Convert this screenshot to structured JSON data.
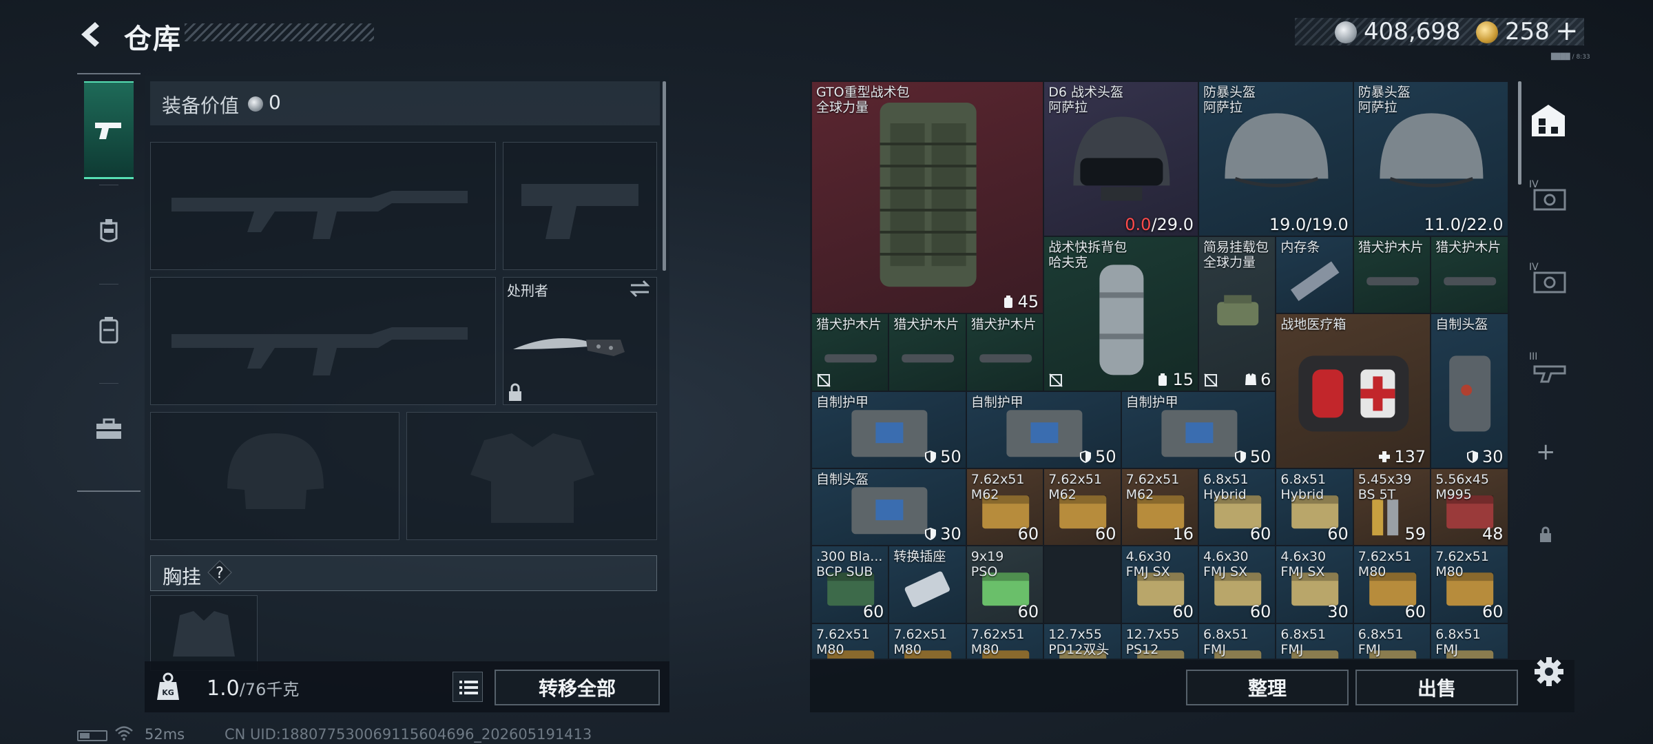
{
  "header": {
    "title": "仓库",
    "silver": "408,698",
    "gold": "258",
    "tiny_text": "████ / 8:33"
  },
  "left": {
    "value_label": "装备价值",
    "value_amount": "0",
    "knife_name": "处刑者",
    "chest_label": "胸挂",
    "chest_help": "?",
    "weight_value": "1.0",
    "weight_max": "/76千克",
    "transfer_all": "转移全部"
  },
  "storage_items": [
    {
      "name": "GTO重型战术包\n全球力量",
      "qty": "45",
      "qty_icon": "backpack-icon",
      "rarity": "red"
    },
    {
      "name": "D6 战术头盔\n阿萨拉",
      "qty_red": "0.0",
      "qty": "/29.0",
      "rarity": "purple"
    },
    {
      "name": "防暴头盔\n阿萨拉",
      "qty": "19.0/19.0",
      "rarity": "blue"
    },
    {
      "name": "防暴头盔\n阿萨拉",
      "qty": "11.0/22.0",
      "rarity": "blue"
    },
    {
      "name": "战术快拆背包\n哈夫克",
      "qty": "15",
      "qty_icon": "backpack-icon",
      "rarity": "green"
    },
    {
      "name": "简易挂载包\n全球力量",
      "qty": "6",
      "qty_icon": "vest-icon",
      "rarity": "gray"
    },
    {
      "name": "内存条",
      "qty": "",
      "rarity": "blue"
    },
    {
      "name": "猎犬护木片",
      "qty": "",
      "rarity": "green"
    },
    {
      "name": "猎犬护木片",
      "qty": "",
      "rarity": "green"
    },
    {
      "name": "猎犬护木片",
      "qty": "",
      "rarity": "green"
    },
    {
      "name": "猎犬护木片",
      "qty": "",
      "rarity": "green"
    },
    {
      "name": "猎犬护木片",
      "qty": "",
      "rarity": "green"
    },
    {
      "name": "战地医疗箱",
      "qty": "137",
      "qty_icon": "plus-icon",
      "rarity": "orange"
    },
    {
      "name": "自制头盔",
      "qty": "30",
      "qty_icon": "shield-icon",
      "rarity": "blue"
    },
    {
      "name": "自制护甲",
      "qty": "50",
      "qty_icon": "shield-icon",
      "rarity": "blue"
    },
    {
      "name": "自制护甲",
      "qty": "50",
      "qty_icon": "shield-icon",
      "rarity": "blue"
    },
    {
      "name": "自制护甲",
      "qty": "50",
      "qty_icon": "shield-icon",
      "rarity": "blue"
    },
    {
      "name": "自制头盔",
      "qty": "30",
      "qty_icon": "shield-icon",
      "rarity": "blue"
    },
    {
      "name": "7.62x51\nM62",
      "qty": "60",
      "rarity": "orange"
    },
    {
      "name": "7.62x51\nM62",
      "qty": "60",
      "rarity": "orange"
    },
    {
      "name": "7.62x51\nM62",
      "qty": "16",
      "rarity": "orange"
    },
    {
      "name": "6.8x51\nHybrid",
      "qty": "60",
      "rarity": "blue"
    },
    {
      "name": "6.8x51\nHybrid",
      "qty": "60",
      "rarity": "blue"
    },
    {
      "name": "5.45x39\nBS 5T",
      "qty": "59",
      "rarity": "orange"
    },
    {
      "name": "5.56x45\nM995",
      "qty": "48",
      "rarity": "orange"
    },
    {
      "name": ".300 Bla...\nBCP SUB",
      "qty": "60",
      "rarity": "blue"
    },
    {
      "name": "转换插座",
      "qty": "",
      "rarity": "blue"
    },
    {
      "name": "9x19\nPSO",
      "qty": "60",
      "rarity": "gray"
    },
    {
      "name": "4.6x30\nFMJ SX",
      "qty": "60",
      "rarity": "blue"
    },
    {
      "name": "4.6x30\nFMJ SX",
      "qty": "60",
      "rarity": "blue"
    },
    {
      "name": "4.6x30\nFMJ SX",
      "qty": "30",
      "rarity": "blue"
    },
    {
      "name": "7.62x51\nM80",
      "qty": "60",
      "rarity": "blue"
    },
    {
      "name": "7.62x51\nM80",
      "qty": "60",
      "rarity": "blue"
    },
    {
      "name": "7.62x51\nM80",
      "qty": "",
      "rarity": "blue"
    },
    {
      "name": "7.62x51\nM80",
      "qty": "",
      "rarity": "blue"
    },
    {
      "name": "7.62x51\nM80",
      "qty": "",
      "rarity": "blue"
    },
    {
      "name": "12.7x55\nPD12双头",
      "qty": "",
      "rarity": "blue"
    },
    {
      "name": "12.7x55\nPS12",
      "qty": "",
      "rarity": "blue"
    },
    {
      "name": "6.8x51\nFMJ",
      "qty": "",
      "rarity": "blue"
    },
    {
      "name": "6.8x51\nFMJ",
      "qty": "",
      "rarity": "blue"
    },
    {
      "name": "6.8x51\nFMJ",
      "qty": "",
      "rarity": "blue"
    },
    {
      "name": "6.8x51\nFMJ",
      "qty": "",
      "rarity": "blue"
    }
  ],
  "right_rail": {
    "tier4a": "IV",
    "tier4b": "IV",
    "tier3": "III",
    "add": "+"
  },
  "buttons": {
    "sort": "整理",
    "sell": "出售"
  },
  "status": {
    "ping": "52ms",
    "uid": "CN UID:18807753006911560​4696_202605191413"
  },
  "colors": {
    "accent_green": "#57e0b4",
    "rarity_red": "#5a2630",
    "rarity_purple": "#35334c",
    "rarity_blue": "#1f3a4e",
    "rarity_green": "#1c3b34",
    "rarity_orange": "#4e3a2b",
    "warning_red": "#ff4b4b"
  }
}
